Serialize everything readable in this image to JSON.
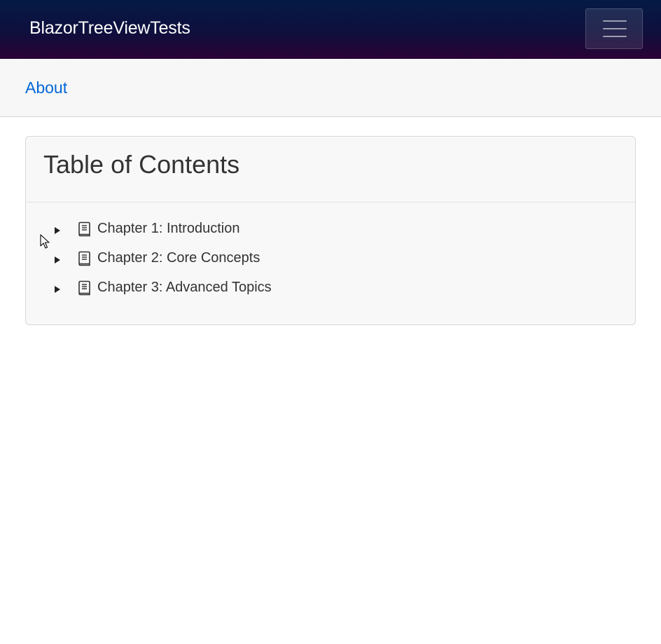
{
  "navbar": {
    "brand": "BlazorTreeViewTests",
    "toggler_icon": "hamburger-menu-icon"
  },
  "subnav": {
    "about_label": "About"
  },
  "toc": {
    "title": "Table of Contents",
    "nodes": [
      {
        "label": "Chapter 1: Introduction",
        "expanded": false,
        "icon": "book-icon"
      },
      {
        "label": "Chapter 2: Core Concepts",
        "expanded": false,
        "icon": "book-icon"
      },
      {
        "label": "Chapter 3: Advanced Topics",
        "expanded": false,
        "icon": "book-icon"
      }
    ]
  },
  "colors": {
    "navbar_top": "#051a45",
    "navbar_bottom": "#2a0336",
    "link": "#0366d6",
    "text": "#333333"
  }
}
